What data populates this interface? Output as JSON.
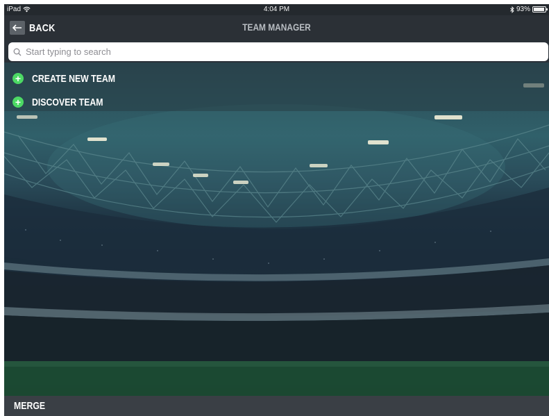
{
  "status_bar": {
    "device": "iPad",
    "time": "4:04 PM",
    "battery": "93%"
  },
  "nav": {
    "back_label": "BACK",
    "title": "TEAM MANAGER"
  },
  "search": {
    "placeholder": "Start typing to search",
    "value": ""
  },
  "menu": {
    "items": [
      {
        "label": "CREATE NEW TEAM",
        "icon": "plus-circle-icon"
      },
      {
        "label": "DISCOVER TEAM",
        "icon": "plus-circle-icon"
      }
    ]
  },
  "bottom_bar": {
    "merge_label": "MERGE"
  },
  "colors": {
    "accent_green": "#4cd964",
    "nav_background": "#2b3036",
    "bottom_bar_background": "#3a3f45"
  }
}
